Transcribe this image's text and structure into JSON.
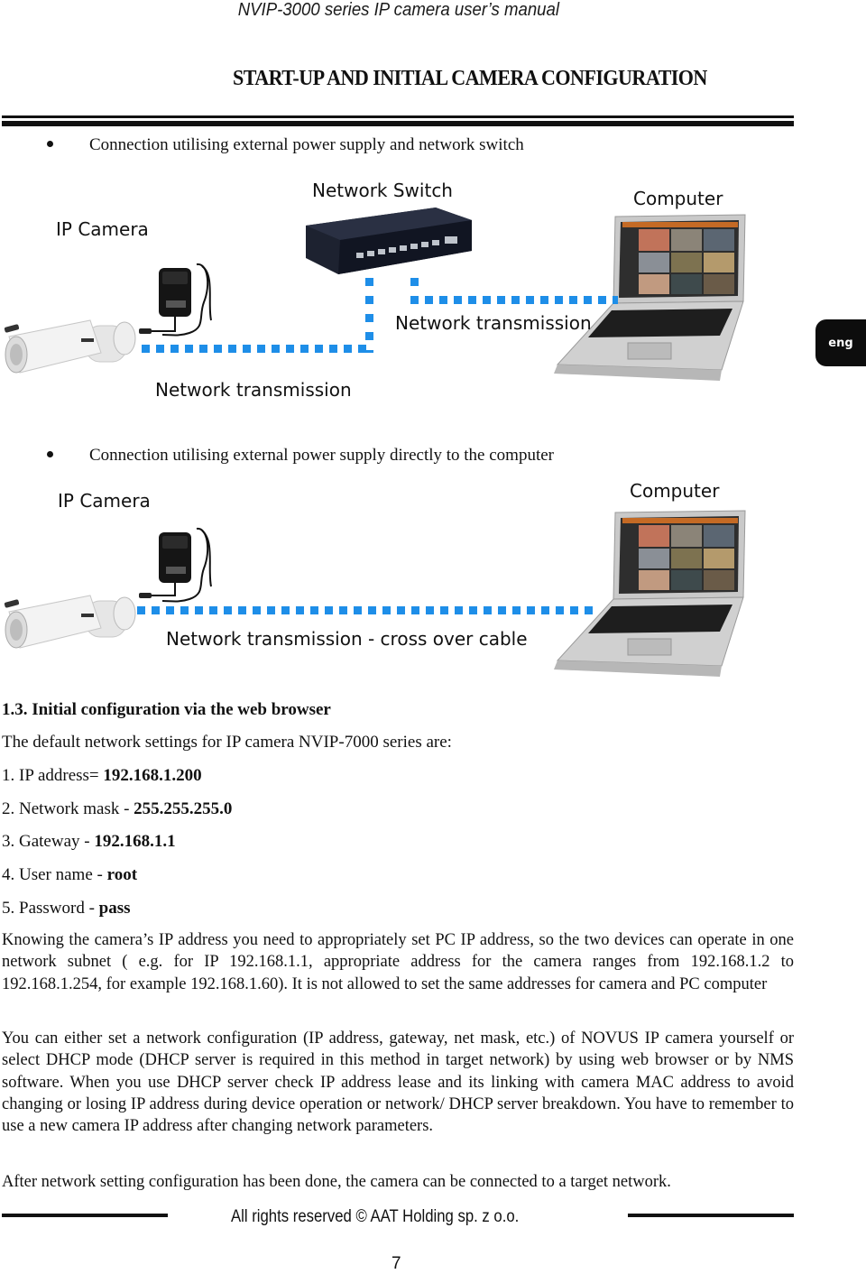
{
  "header": {
    "running_title": "NVIP-3000 series IP camera user’s manual",
    "chapter_title": "START-UP AND INITIAL CAMERA CONFIGURATION"
  },
  "side_tab": {
    "label": "eng"
  },
  "diagram1": {
    "bullet": "Connection utilising external power supply and network switch",
    "labels": {
      "camera": "IP Camera",
      "switch": "Network Switch",
      "computer": "Computer",
      "link_camera_switch": "Network transmission",
      "link_switch_computer": "Network transmission"
    },
    "link_color": "#1e8ee8"
  },
  "diagram2": {
    "bullet": "Connection utilising external power supply directly to the computer",
    "labels": {
      "camera": "IP Camera",
      "computer": "Computer",
      "link": "Network transmission - cross over cable"
    }
  },
  "section": {
    "number_title": "1.3. Initial configuration via the web browser",
    "intro": "The default network settings for IP camera  NVIP-7000 series are:",
    "settings": [
      {
        "label": "1. IP address= ",
        "value": "192.168.1.200"
      },
      {
        "label": "2. Network mask - ",
        "value": "255.255.255.0"
      },
      {
        "label": "3. Gateway - ",
        "value": "192.168.1.1"
      },
      {
        "label": "4. User name - ",
        "value": "root"
      },
      {
        "label": "5. Password - ",
        "value": "pass"
      }
    ],
    "paragraphs": [
      "Knowing the camera’s IP address you need to appropriately set PC IP address, so the two devices can operate in one network subnet ( e.g. for IP 192.168.1.1, appropriate address for the camera ranges from 192.168.1.2 to 192.168.1.254, for example 192.168.1.60). It is not allowed to set the same addresses for camera and PC computer",
      "You can either set a network configuration (IP address, gateway, net mask, etc.) of NOVUS IP camera yourself or select DHCP mode (DHCP server is required in this method in target network) by using web browser or by NMS software. When you use DHCP server check IP address lease and its linking with camera MAC address to avoid changing or losing IP address during device operation or network/ DHCP server breakdown. You have to remember to use a new camera IP address after changing network parameters.",
      "After network setting configuration has been done, the camera can be connected to a target network."
    ]
  },
  "footer": {
    "copyright": "All rights reserved © AAT Holding sp. z o.o.",
    "page_number": "7"
  }
}
